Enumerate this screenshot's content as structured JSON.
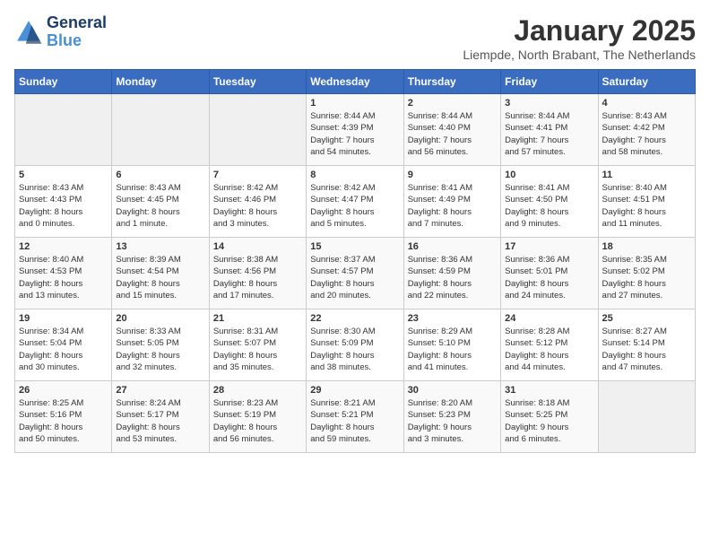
{
  "header": {
    "logo_line1": "General",
    "logo_line2": "Blue",
    "month_title": "January 2025",
    "location": "Liempde, North Brabant, The Netherlands"
  },
  "days_of_week": [
    "Sunday",
    "Monday",
    "Tuesday",
    "Wednesday",
    "Thursday",
    "Friday",
    "Saturday"
  ],
  "weeks": [
    [
      {
        "day": "",
        "info": ""
      },
      {
        "day": "",
        "info": ""
      },
      {
        "day": "",
        "info": ""
      },
      {
        "day": "1",
        "info": "Sunrise: 8:44 AM\nSunset: 4:39 PM\nDaylight: 7 hours\nand 54 minutes."
      },
      {
        "day": "2",
        "info": "Sunrise: 8:44 AM\nSunset: 4:40 PM\nDaylight: 7 hours\nand 56 minutes."
      },
      {
        "day": "3",
        "info": "Sunrise: 8:44 AM\nSunset: 4:41 PM\nDaylight: 7 hours\nand 57 minutes."
      },
      {
        "day": "4",
        "info": "Sunrise: 8:43 AM\nSunset: 4:42 PM\nDaylight: 7 hours\nand 58 minutes."
      }
    ],
    [
      {
        "day": "5",
        "info": "Sunrise: 8:43 AM\nSunset: 4:43 PM\nDaylight: 8 hours\nand 0 minutes."
      },
      {
        "day": "6",
        "info": "Sunrise: 8:43 AM\nSunset: 4:45 PM\nDaylight: 8 hours\nand 1 minute."
      },
      {
        "day": "7",
        "info": "Sunrise: 8:42 AM\nSunset: 4:46 PM\nDaylight: 8 hours\nand 3 minutes."
      },
      {
        "day": "8",
        "info": "Sunrise: 8:42 AM\nSunset: 4:47 PM\nDaylight: 8 hours\nand 5 minutes."
      },
      {
        "day": "9",
        "info": "Sunrise: 8:41 AM\nSunset: 4:49 PM\nDaylight: 8 hours\nand 7 minutes."
      },
      {
        "day": "10",
        "info": "Sunrise: 8:41 AM\nSunset: 4:50 PM\nDaylight: 8 hours\nand 9 minutes."
      },
      {
        "day": "11",
        "info": "Sunrise: 8:40 AM\nSunset: 4:51 PM\nDaylight: 8 hours\nand 11 minutes."
      }
    ],
    [
      {
        "day": "12",
        "info": "Sunrise: 8:40 AM\nSunset: 4:53 PM\nDaylight: 8 hours\nand 13 minutes."
      },
      {
        "day": "13",
        "info": "Sunrise: 8:39 AM\nSunset: 4:54 PM\nDaylight: 8 hours\nand 15 minutes."
      },
      {
        "day": "14",
        "info": "Sunrise: 8:38 AM\nSunset: 4:56 PM\nDaylight: 8 hours\nand 17 minutes."
      },
      {
        "day": "15",
        "info": "Sunrise: 8:37 AM\nSunset: 4:57 PM\nDaylight: 8 hours\nand 20 minutes."
      },
      {
        "day": "16",
        "info": "Sunrise: 8:36 AM\nSunset: 4:59 PM\nDaylight: 8 hours\nand 22 minutes."
      },
      {
        "day": "17",
        "info": "Sunrise: 8:36 AM\nSunset: 5:01 PM\nDaylight: 8 hours\nand 24 minutes."
      },
      {
        "day": "18",
        "info": "Sunrise: 8:35 AM\nSunset: 5:02 PM\nDaylight: 8 hours\nand 27 minutes."
      }
    ],
    [
      {
        "day": "19",
        "info": "Sunrise: 8:34 AM\nSunset: 5:04 PM\nDaylight: 8 hours\nand 30 minutes."
      },
      {
        "day": "20",
        "info": "Sunrise: 8:33 AM\nSunset: 5:05 PM\nDaylight: 8 hours\nand 32 minutes."
      },
      {
        "day": "21",
        "info": "Sunrise: 8:31 AM\nSunset: 5:07 PM\nDaylight: 8 hours\nand 35 minutes."
      },
      {
        "day": "22",
        "info": "Sunrise: 8:30 AM\nSunset: 5:09 PM\nDaylight: 8 hours\nand 38 minutes."
      },
      {
        "day": "23",
        "info": "Sunrise: 8:29 AM\nSunset: 5:10 PM\nDaylight: 8 hours\nand 41 minutes."
      },
      {
        "day": "24",
        "info": "Sunrise: 8:28 AM\nSunset: 5:12 PM\nDaylight: 8 hours\nand 44 minutes."
      },
      {
        "day": "25",
        "info": "Sunrise: 8:27 AM\nSunset: 5:14 PM\nDaylight: 8 hours\nand 47 minutes."
      }
    ],
    [
      {
        "day": "26",
        "info": "Sunrise: 8:25 AM\nSunset: 5:16 PM\nDaylight: 8 hours\nand 50 minutes."
      },
      {
        "day": "27",
        "info": "Sunrise: 8:24 AM\nSunset: 5:17 PM\nDaylight: 8 hours\nand 53 minutes."
      },
      {
        "day": "28",
        "info": "Sunrise: 8:23 AM\nSunset: 5:19 PM\nDaylight: 8 hours\nand 56 minutes."
      },
      {
        "day": "29",
        "info": "Sunrise: 8:21 AM\nSunset: 5:21 PM\nDaylight: 8 hours\nand 59 minutes."
      },
      {
        "day": "30",
        "info": "Sunrise: 8:20 AM\nSunset: 5:23 PM\nDaylight: 9 hours\nand 3 minutes."
      },
      {
        "day": "31",
        "info": "Sunrise: 8:18 AM\nSunset: 5:25 PM\nDaylight: 9 hours\nand 6 minutes."
      },
      {
        "day": "",
        "info": ""
      }
    ]
  ]
}
